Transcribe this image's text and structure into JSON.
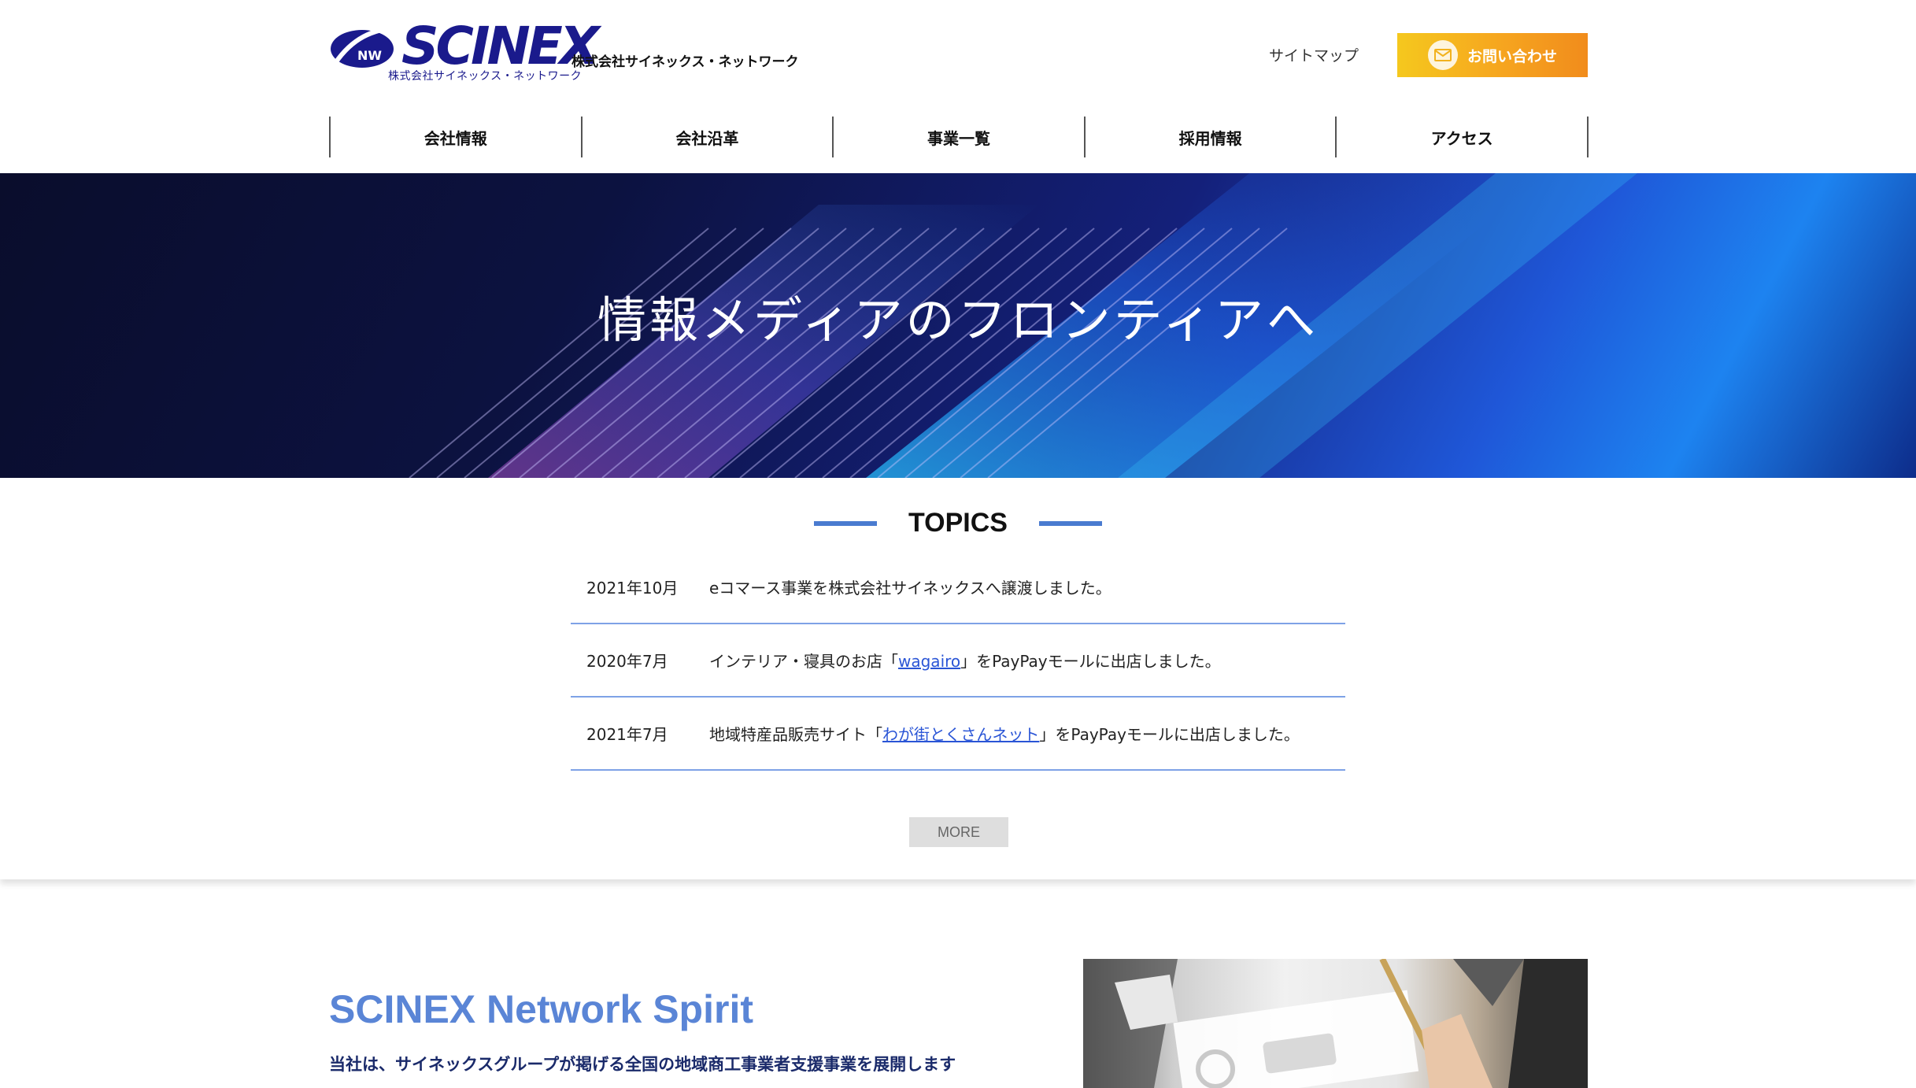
{
  "brand": {
    "logo_badge": "NW",
    "logo_text": "SCINEX",
    "logo_subtext": "株式会社サイネックス・ネットワーク",
    "company_name": "株式会社サイネックス・ネットワーク"
  },
  "header": {
    "sitemap_label": "サイトマップ",
    "contact_label": "お問い合わせ",
    "contact_icon": "mail-icon"
  },
  "nav": {
    "items": [
      {
        "label": "会社情報"
      },
      {
        "label": "会社沿革"
      },
      {
        "label": "事業一覧"
      },
      {
        "label": "採用情報"
      },
      {
        "label": "アクセス"
      }
    ]
  },
  "hero": {
    "title": "情報メディアのフロンティアへ"
  },
  "topics": {
    "heading": "TOPICS",
    "items": [
      {
        "date": "2021年10月",
        "before": "eコマース事業を株式会社サイネックスへ譲渡しました。",
        "link": "",
        "after": ""
      },
      {
        "date": "2020年7月",
        "before": "インテリア・寝具のお店「",
        "link": "wagairo",
        "after": "」をPayPayモールに出店しました。"
      },
      {
        "date": "2021年7月",
        "before": "地域特産品販売サイト「",
        "link": "わが街とくさんネット",
        "after": "」をPayPayモールに出店しました。"
      }
    ],
    "more_label": "MORE"
  },
  "spirit": {
    "title": "SCINEX Network Spirit",
    "description": "当社は、サイネックスグループが掲げる全国の地域商工事業者支援事業を展開します"
  },
  "colors": {
    "accent_blue": "#4a7bd0",
    "link_blue": "#2a55d6",
    "contact_orange": "#f6a51f",
    "brand_navy": "#1a1a8c"
  }
}
